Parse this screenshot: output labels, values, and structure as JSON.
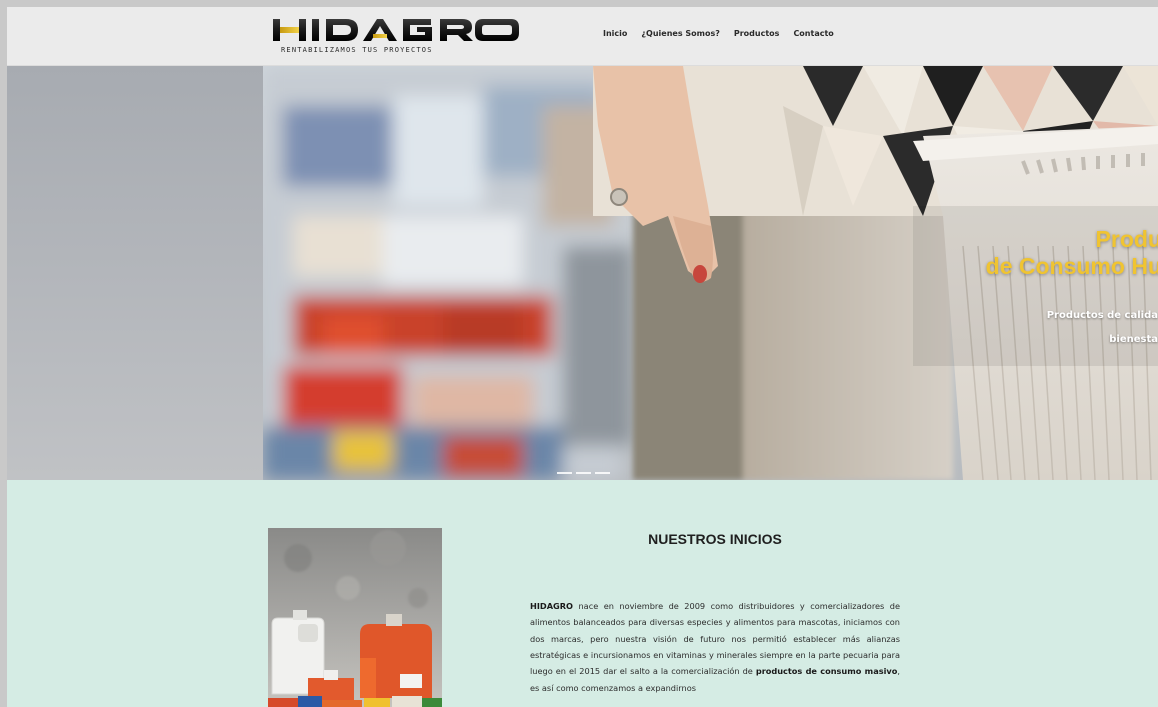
{
  "header": {
    "logo_text": "HIDAGRO",
    "logo_tagline": "RENTABILIZAMOS TUS PROYECTOS",
    "nav": [
      {
        "label": "Inicio"
      },
      {
        "label": "¿Quienes Somos?"
      },
      {
        "label": "Productos"
      },
      {
        "label": "Contacto"
      }
    ]
  },
  "hero": {
    "title_line1": "Produ",
    "title_line2": "de Consumo Hu",
    "subtitle_line1": "Productos de calida",
    "subtitle_line2": "bienesta",
    "slide_count": 3,
    "active_slide": 1
  },
  "about": {
    "title": "NUESTROS INICIOS",
    "p_strong1": "HIDAGRO",
    "p_text1": " nace en noviembre de 2009 como distribuidores y comercializadores de alimentos balanceados para diversas especies y alimentos para mascotas, iniciamos con dos marcas, pero nuestra visión de futuro nos permitió establecer más alianzas estratégicas e incursionamos en vitaminas y minerales siempre en la parte pecuaria para luego en el 2015 dar el salto a la comercialización de ",
    "p_strong2": "productos de consumo masivo",
    "p_text2": ", es así como comenzamos a expandirnos"
  },
  "colors": {
    "accent_yellow": "#f0c431",
    "section_bg": "#d5ece4",
    "header_bg": "#ebebeb"
  }
}
